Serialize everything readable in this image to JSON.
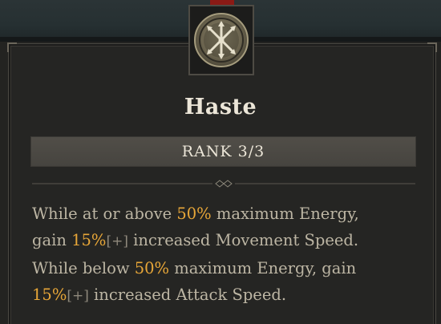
{
  "skill": {
    "icon": "haste-skill-icon",
    "name": "Haste",
    "rank": "RANK 3/3",
    "description": {
      "line1": {
        "t1": "While at or above ",
        "v1": "50%",
        "t2": " maximum Energy,"
      },
      "line2": {
        "t1": "gain ",
        "v1": "15%",
        "plus": "[+]",
        "t2": " increased Movement Speed."
      },
      "line3": {
        "t1": "While below ",
        "v1": "50%",
        "t2": " maximum Energy, gain"
      },
      "line4": {
        "v1": "15%",
        "plus": "[+]",
        "t2": " increased Attack Speed."
      }
    }
  },
  "colors": {
    "highlight": "#e7a638",
    "text": "#bdb6a4",
    "title": "#ece6d8",
    "panel": "#252523",
    "rank_bar": "#4a4843"
  }
}
